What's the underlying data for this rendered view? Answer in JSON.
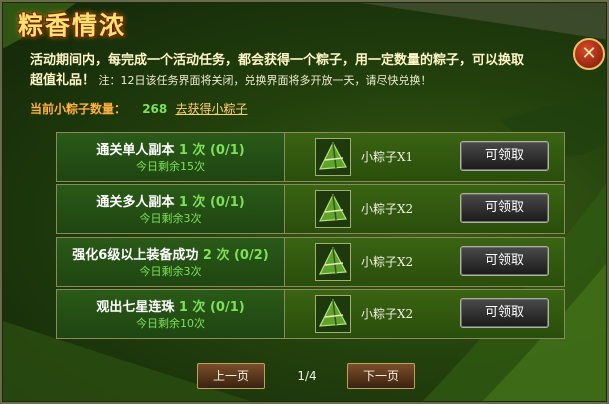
{
  "title": "粽香情浓",
  "close_glyph": "✕",
  "description_line1": "活动期间内，每完成一个活动任务，都会获得一个粽子，用一定数量的粽子，可以换取",
  "description_gift": "超值礼品！",
  "description_note": "注：12日该任务界面将关闭，兑换界面将多开放一天，请尽快兑换！",
  "count_label": "当前小粽子数量：",
  "count_value": "268",
  "count_link": "去获得小粽子",
  "tasks": [
    {
      "name": "通关单人副本",
      "times": "1 次 (0/1)",
      "remain": "今日剩余15次",
      "reward": "小粽子X1",
      "button": "可领取"
    },
    {
      "name": "通关多人副本",
      "times": "1 次 (0/1)",
      "remain": "今日剩余3次",
      "reward": "小粽子X2",
      "button": "可领取"
    },
    {
      "name": "强化6级以上装备成功",
      "times": "2 次 (0/2)",
      "remain": "今日剩余3次",
      "reward": "小粽子X2",
      "button": "可领取"
    },
    {
      "name": "观出七星连珠",
      "times": "1 次 (0/1)",
      "remain": "今日剩余10次",
      "reward": "小粽子X2",
      "button": "可领取"
    }
  ],
  "pagination": {
    "prev": "上一页",
    "page": "1/4",
    "next": "下一页"
  }
}
